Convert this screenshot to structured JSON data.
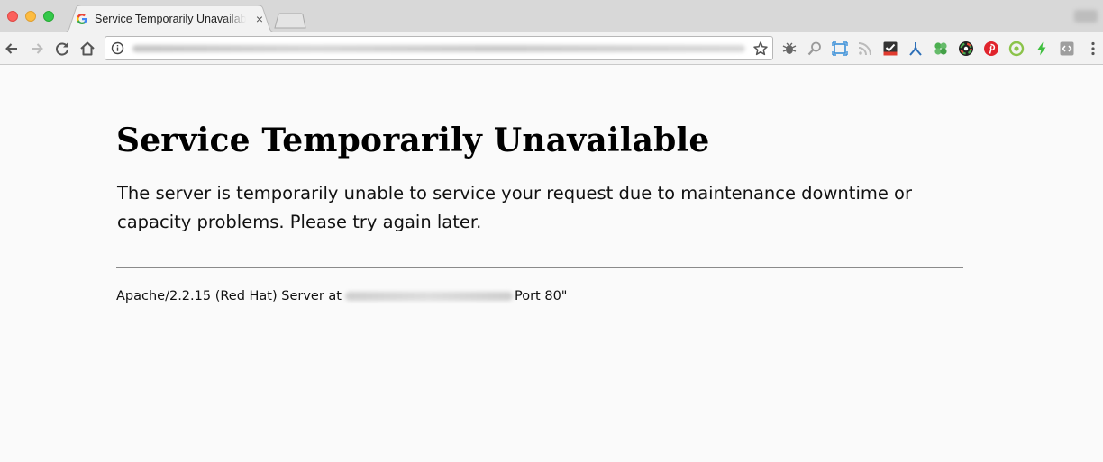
{
  "browser": {
    "tab": {
      "title": "Service Temporarily Unavailable",
      "close_glyph": "×",
      "favicon": "google-g-icon"
    },
    "toolbar_icons": [
      "back-arrow-icon",
      "forward-arrow-icon",
      "reload-icon",
      "home-icon",
      "info-icon",
      "star-icon",
      "menu-dots-icon"
    ],
    "extension_icons": [
      "bug-extension-icon",
      "magnifier-extension-icon",
      "screen-capture-extension-icon",
      "rss-extension-icon",
      "checkbox-extension-icon",
      "fork-extension-icon",
      "clover-extension-icon",
      "color-picker-extension-icon",
      "pinterest-extension-icon",
      "green-circle-extension-icon",
      "lightning-extension-icon",
      "code-extension-icon"
    ]
  },
  "page": {
    "heading": "Service Temporarily Unavailable",
    "message": "The server is temporarily unable to service your request due to maintenance downtime or capacity problems. Please try again later.",
    "footer_prefix": "Apache/2.2.15 (Red Hat) Server at",
    "footer_suffix": "Port 80\""
  },
  "colors": {
    "page_background": "#fafafa",
    "tabstrip_background": "#d8d8d8",
    "toolbar_background": "#f2f2f2"
  }
}
